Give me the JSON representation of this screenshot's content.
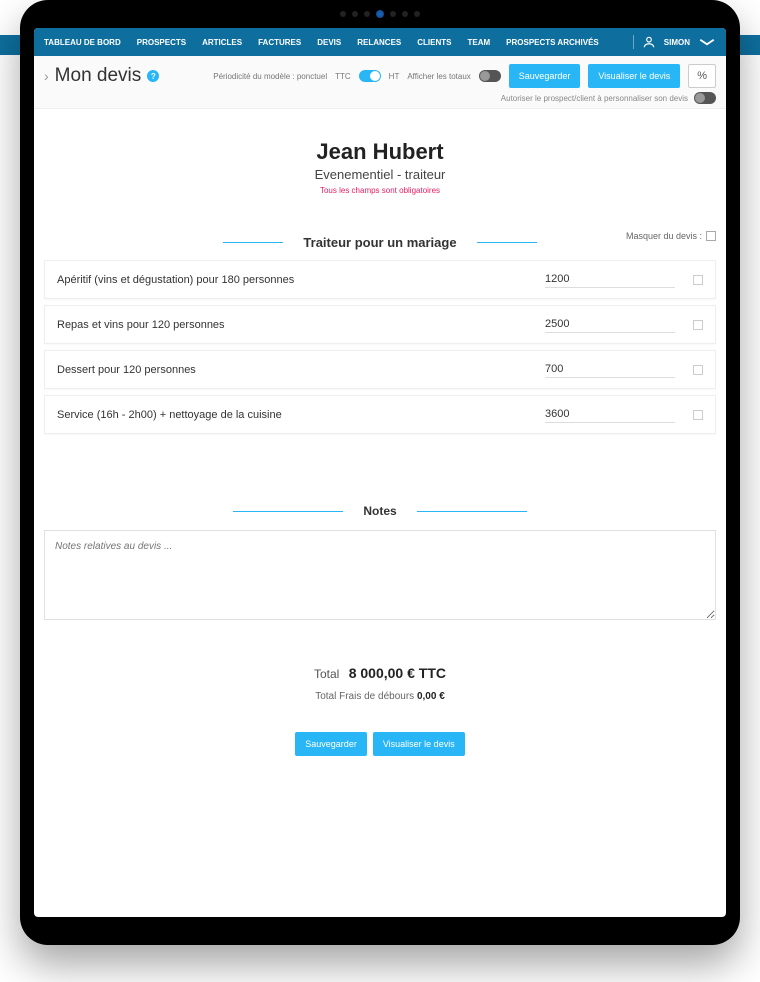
{
  "nav": {
    "items": [
      "TABLEAU DE BORD",
      "PROSPECTS",
      "ARTICLES",
      "FACTURES",
      "DEVIS",
      "RELANCES",
      "CLIENTS",
      "TEAM",
      "PROSPECTS ARCHIVÉS"
    ],
    "user": "SIMON"
  },
  "subheader": {
    "title": "Mon devis",
    "periodicity_label": "Périodicité du modèle : ponctuel",
    "ttc": "TTC",
    "ht": "HT",
    "show_totals": "Afficher les totaux",
    "save": "Sauvegarder",
    "view": "Visualiser le devis",
    "percent": "%",
    "allow_customize": "Autoriser le prospect/client à personnaliser son devis"
  },
  "client": {
    "name": "Jean Hubert",
    "subtitle": "Evenementiel - traiteur",
    "note": "Tous les champs sont obligatoires"
  },
  "section": {
    "title": "Traiteur pour un mariage",
    "mask_label": "Masquer du devis :"
  },
  "items": [
    {
      "desc": "Apéritif (vins et dégustation) pour 180 personnes",
      "price": "1200"
    },
    {
      "desc": "Repas et vins pour 120 personnes",
      "price": "2500"
    },
    {
      "desc": "Dessert pour 120 personnes",
      "price": "700"
    },
    {
      "desc": "Service (16h - 2h00) + nettoyage de la cuisine",
      "price": "3600"
    }
  ],
  "notes": {
    "title": "Notes",
    "placeholder": "Notes relatives au devis ..."
  },
  "totals": {
    "label": "Total",
    "amount": "8 000,00 € TTC",
    "debours_label": "Total Frais de débours",
    "debours_amount": "0,00 €"
  },
  "footer": {
    "save": "Sauvegarder",
    "view": "Visualiser le devis"
  }
}
